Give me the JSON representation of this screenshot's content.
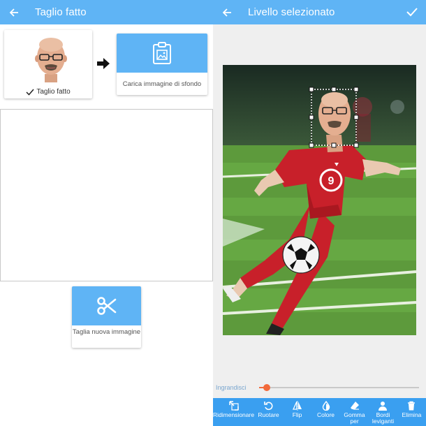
{
  "left_screen": {
    "header": {
      "title": "Taglio fatto"
    },
    "done_card": {
      "label": "Taglio fatto"
    },
    "background_card": {
      "label": "Carica immagine di sfondo"
    },
    "cut_card": {
      "label": "Taglia nuova immagine"
    }
  },
  "right_screen": {
    "header": {
      "title": "Livello selezionato"
    },
    "zoom": {
      "label": "Ingrandisci",
      "value": 0.05
    },
    "toolbar": [
      {
        "name": "resize",
        "label": "Ridimensionare",
        "icon": "resize-icon"
      },
      {
        "name": "rotate",
        "label": "Ruotare",
        "icon": "rotate-icon"
      },
      {
        "name": "flip",
        "label": "Flip",
        "icon": "flip-icon"
      },
      {
        "name": "color",
        "label": "Colore",
        "icon": "color-drop-icon"
      },
      {
        "name": "eraser",
        "label": "Gomma per",
        "icon": "eraser-icon"
      },
      {
        "name": "smooth-edges",
        "label": "Bordi leviganti",
        "icon": "person-icon"
      },
      {
        "name": "delete",
        "label": "Elimina",
        "icon": "trash-icon"
      }
    ]
  },
  "colors": {
    "primary": "#5fb4f5",
    "toolbar": "#3a9ff0",
    "slider": "#f26a3b"
  }
}
